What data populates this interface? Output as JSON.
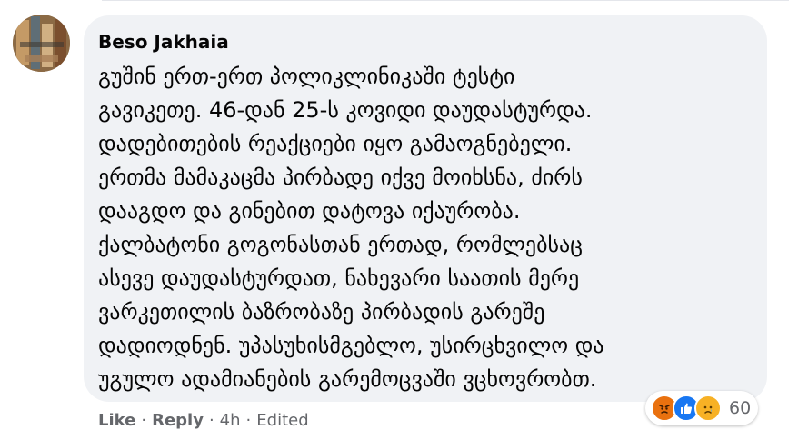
{
  "comment": {
    "author": "Beso Jakhaia",
    "text_lines": [
      "გუშინ ერთ-ერთ პოლიკლინიკაში ტესტი",
      "გავიკეთე. 46-დან 25-ს კოვიდი დაუდასტურდა.",
      "დადებითების რეაქციები იყო გამაოგნებელი.",
      "ერთმა მამაკაცმა პირბადე იქვე მოიხსნა, ძირს",
      "დააგდო და გინებით დატოვა იქაურობა.",
      "ქალბატონი გოგონასთან ერთად, რომლებსაც",
      "ასევე დაუდასტურდათ, ნახევარი საათის მერე",
      "ვარკეთილის ბაზრობაზე პირბადის გარეშე",
      "დადიოდნენ. უპასუხისმგებლო, უსირცხვილო და",
      "უგულო ადამიანების გარემოცვაში ვცხოვრობთ."
    ],
    "reactions": {
      "icons": [
        "angry-icon",
        "like-icon",
        "sad-icon"
      ],
      "count": "60"
    },
    "actions": {
      "like_label": "Like",
      "reply_label": "Reply",
      "separator": "·",
      "time": "4h",
      "edited_label": "Edited"
    },
    "colors": {
      "bubble": "#f0f2f5",
      "text": "#050505",
      "meta": "#65676b",
      "like_blue": "#1877f2",
      "angry_orange": "#e9710f",
      "sad_yellow": "#f7b125"
    }
  }
}
